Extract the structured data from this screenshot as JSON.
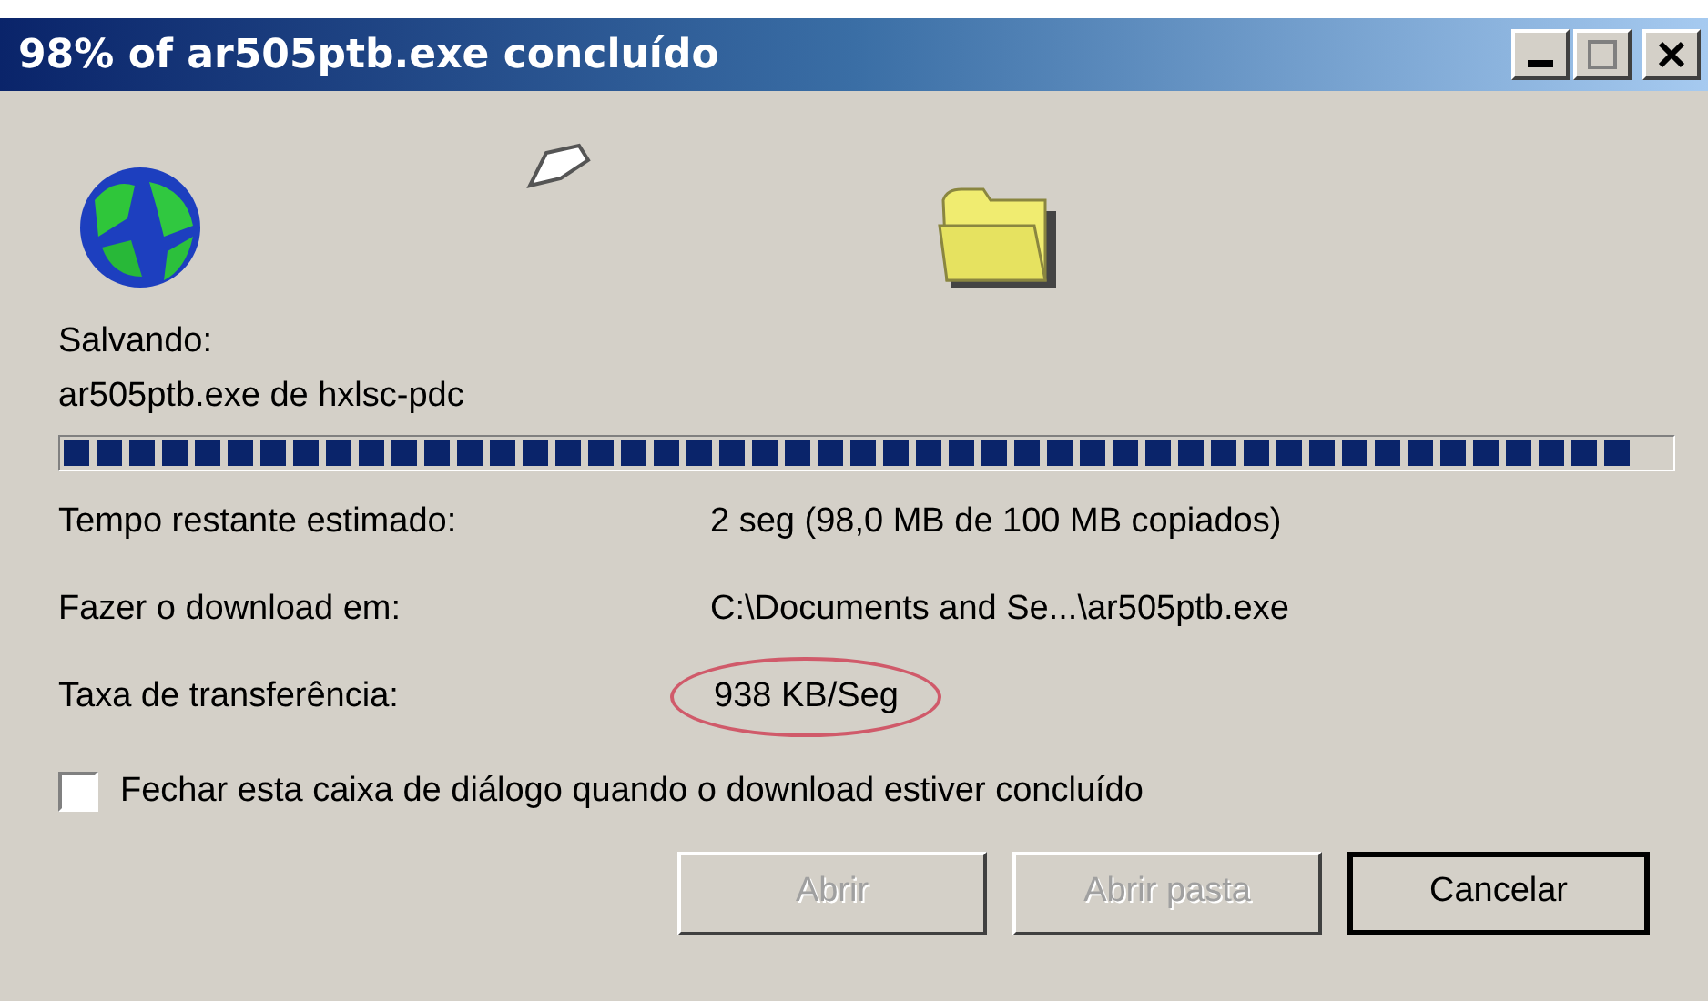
{
  "window": {
    "title": "98% of ar505ptb.exe concluído"
  },
  "status": {
    "label": "Salvando:",
    "file": "ar505ptb.exe de hxlsc-pdc"
  },
  "progress": {
    "level": 0.98
  },
  "details": [
    {
      "label": "Tempo restante estimado:",
      "value": "2 seg (98,0 MB de 100 MB copiados)",
      "highlighted": false
    },
    {
      "label": "Fazer o download em:",
      "value": "C:\\Documents and Se...\\ar505ptb.exe",
      "highlighted": false
    },
    {
      "label": "Taxa de transferência:",
      "value": "938 KB/Seg",
      "highlighted": true
    }
  ],
  "checkbox": {
    "label": "Fechar esta caixa de diálogo quando o download estiver concluído",
    "checked": false
  },
  "buttons": [
    {
      "label": "Abrir",
      "disabled": true
    },
    {
      "label": "Abrir pasta",
      "disabled": true
    },
    {
      "label": "Cancelar",
      "disabled": false
    }
  ]
}
